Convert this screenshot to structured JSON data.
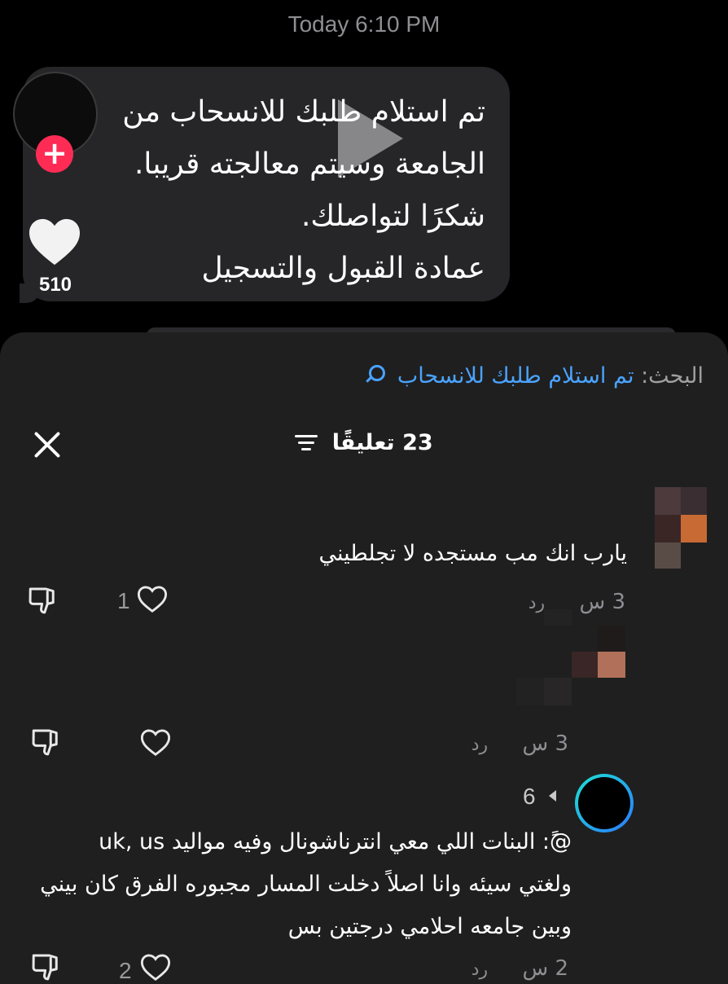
{
  "message": {
    "timestamp": "Today 6:10 PM",
    "lines": [
      "تم استلام طلبك للانسحاب من",
      "الجامعة وسيتم معالجته قريبا.",
      "شكرًا لتواصلك.",
      "عمادة القبول والتسجيل"
    ],
    "like_count": "510",
    "follow_badge": "+"
  },
  "sheet": {
    "search_label": "البحث:",
    "search_query": "تم استلام طلبك للانسحاب",
    "comments_count": "23 تعليقًا"
  },
  "comments": [
    {
      "text": "يارب انك مب مستجده لا تجلطيني",
      "time": "3 س",
      "reply_label": "رد",
      "like_count": "1"
    },
    {
      "time": "3 س",
      "reply_label": "رد",
      "like_count": ""
    },
    {
      "replies_count": "6",
      "lines": [
        "@ً: البنات اللي معي انترناشونال وفيه مواليد uk, us",
        "ولغتي سيئه وانا اصلاً دخلت المسار مجبوره الفرق كان بيني",
        "وبين جامعه احلامي درجتين بس"
      ],
      "time": "2 س",
      "reply_label": "رد",
      "like_count": "2"
    }
  ],
  "colors": {
    "accent_pink": "#fe2c55",
    "link_blue": "#4aa3ff",
    "sheet_bg": "#1f1f1f",
    "bubble_bg": "#262628"
  },
  "icons": [
    "plus-icon",
    "heart-icon",
    "play-icon",
    "search-icon",
    "close-icon",
    "filter-icon",
    "dislike-icon"
  ]
}
